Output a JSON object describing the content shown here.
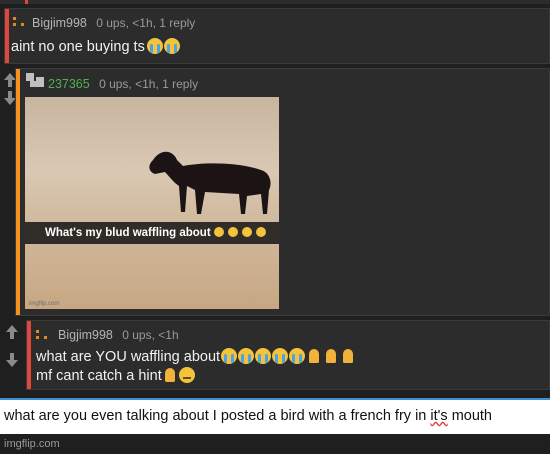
{
  "comments": [
    {
      "username": "Bigjim998",
      "meta": "0 ups, <1h, 1 reply",
      "text": "aint no one buying ts",
      "accent": "#e0463c"
    },
    {
      "username": "237365",
      "meta": "0 ups, <1h, 1 reply",
      "accent": "#f5911e",
      "image_caption": "What's my blud waffling about",
      "image_watermark": "imgflip.com"
    },
    {
      "username": "Bigjim998",
      "meta": "0 ups, <1h",
      "line1": "what are YOU waffling about",
      "line2": "mf cant catch a hint",
      "accent": "#e0463c"
    }
  ],
  "reply": {
    "text_before": "what are you even talking about I posted a bird with a french fry in ",
    "misspelled": "it's",
    "text_after": " mouth"
  },
  "footer": "imgflip.com",
  "colors": {
    "accent_blue": "#3d8fcf",
    "orange": "#f5911e",
    "red": "#e0463c"
  },
  "icons": [
    "upvote-arrow-icon",
    "downvote-arrow-icon",
    "loudly-crying-face-emoji",
    "folded-hands-emoji",
    "pensive-face-emoji"
  ]
}
